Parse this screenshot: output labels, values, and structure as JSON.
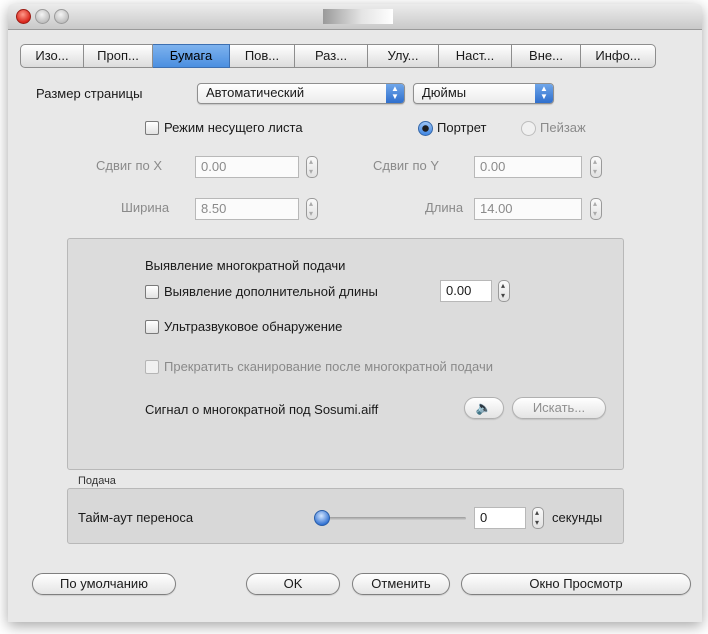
{
  "tabs": [
    {
      "label": "Изо...",
      "active": false
    },
    {
      "label": "Проп...",
      "active": false
    },
    {
      "label": "Бумага",
      "active": true
    },
    {
      "label": "Пов...",
      "active": false
    },
    {
      "label": "Раз...",
      "active": false
    },
    {
      "label": "Улу...",
      "active": false
    },
    {
      "label": "Наст...",
      "active": false
    },
    {
      "label": "Вне...",
      "active": false
    },
    {
      "label": "Инфо...",
      "active": false
    }
  ],
  "page_size": {
    "label": "Размер страницы",
    "value": "Автоматический",
    "unit": "Дюймы"
  },
  "carrier_sheet": {
    "label": "Режим несущего листа",
    "checked": false
  },
  "orientation": {
    "portrait": "Портрет",
    "landscape": "Пейзаж",
    "selected": "Портрет"
  },
  "offset_x": {
    "label": "Сдвиг по X",
    "value": "0.00"
  },
  "offset_y": {
    "label": "Сдвиг по Y",
    "value": "0.00"
  },
  "width": {
    "label": "Ширина",
    "value": "8.50"
  },
  "length": {
    "label": "Длина",
    "value": "14.00"
  },
  "multifeed": {
    "title": "Выявление многократной подачи",
    "extra_length": {
      "label": "Выявление дополнительной длины",
      "value": "0.00",
      "checked": false
    },
    "ultrasonic": {
      "label": "Ультразвуковое обнаружение",
      "checked": false
    },
    "stop_scan": {
      "label": "Прекратить сканирование после многократной подачи",
      "checked": false
    },
    "signal": {
      "label": "Сигнал о многократной под Sosumi.aiff",
      "play_icon": "speaker-icon",
      "browse": "Искать..."
    }
  },
  "feed": {
    "group_label": "Подача",
    "transfer_timeout": {
      "label": "Тайм-аут переноса",
      "value": "0",
      "unit": "секунды",
      "slider_fraction": 0.0
    }
  },
  "buttons": {
    "default": "По умолчанию",
    "ok": "OK",
    "cancel": "Отменить",
    "preview": "Окно Просмотр"
  }
}
